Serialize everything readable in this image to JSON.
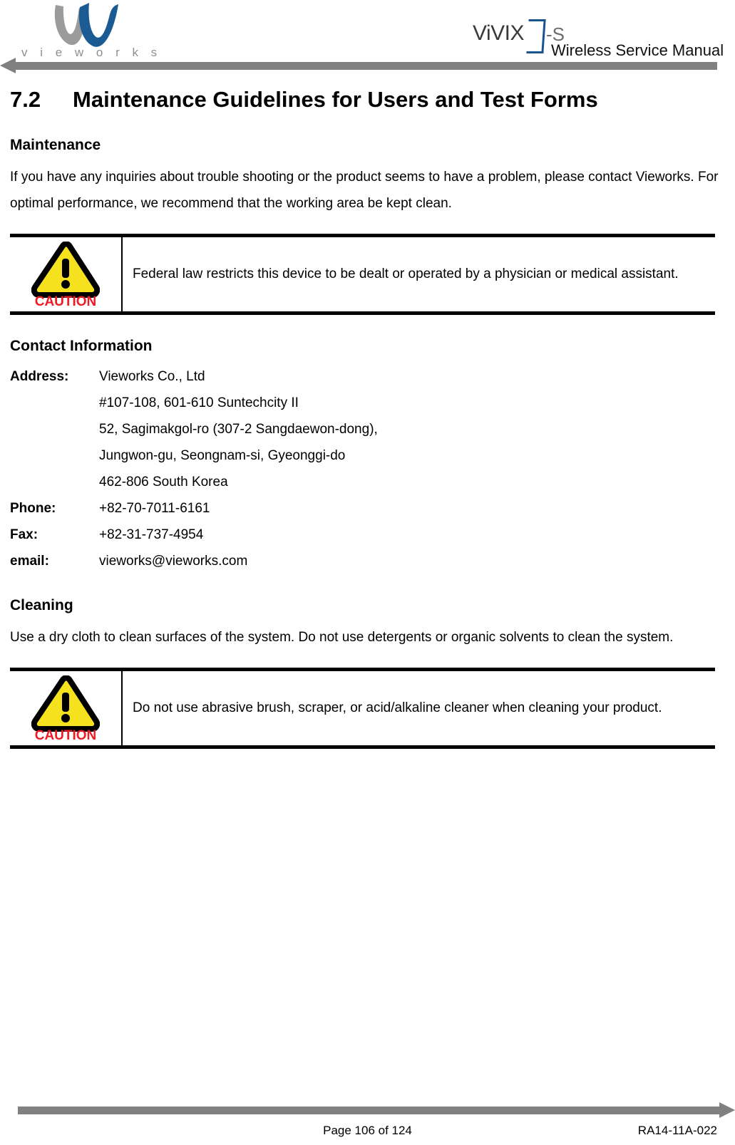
{
  "header": {
    "logo_wordmark": "v i e w o r k s",
    "logo_icon": "vieworks-w-logo",
    "product_logo_text": "ViVIX",
    "product_logo_suffix": "-S",
    "manual_title": "Wireless Service Manual"
  },
  "section": {
    "number": "7.2",
    "title": "Maintenance Guidelines for Users and Test Forms"
  },
  "maintenance": {
    "heading": "Maintenance",
    "paragraph": "If you have any inquiries about trouble shooting or the product seems to have a problem, please contact Vieworks. For optimal performance, we recommend that the working area be kept clean.",
    "caution": {
      "label": "CAUTION",
      "icon": "caution-triangle-icon",
      "text": "Federal law restricts this device to be dealt or operated by a physician or medical assistant."
    }
  },
  "contact": {
    "heading": "Contact Information",
    "rows": [
      {
        "label": "Address:",
        "values": [
          "Vieworks Co., Ltd",
          "#107-108, 601-610 Suntechcity II",
          "52, Sagimakgol-ro (307-2 Sangdaewon-dong),",
          "Jungwon-gu, Seongnam-si, Gyeonggi-do",
          "462-806 South Korea"
        ]
      },
      {
        "label": "Phone:",
        "values": [
          "+82-70-7011-6161"
        ]
      },
      {
        "label": "Fax:",
        "values": [
          "+82-31-737-4954"
        ]
      },
      {
        "label": "email:",
        "values": [
          "vieworks@vieworks.com"
        ]
      }
    ]
  },
  "cleaning": {
    "heading": "Cleaning",
    "paragraph": "Use a dry cloth to clean surfaces of the system. Do not use detergents or organic solvents to clean the system.",
    "caution": {
      "label": "CAUTION",
      "icon": "caution-triangle-icon",
      "text": "Do not use abrasive brush, scraper, or acid/alkaline cleaner when cleaning your product."
    }
  },
  "footer": {
    "page": "Page 106 of 124",
    "doc_code": "RA14-11A-022"
  },
  "colors": {
    "brand_blue": "#17548f",
    "brand_gray": "#8f8f8f",
    "rule_gray": "#808080",
    "caution_yellow": "#f5e11e",
    "caution_red": "#ee1c25"
  }
}
